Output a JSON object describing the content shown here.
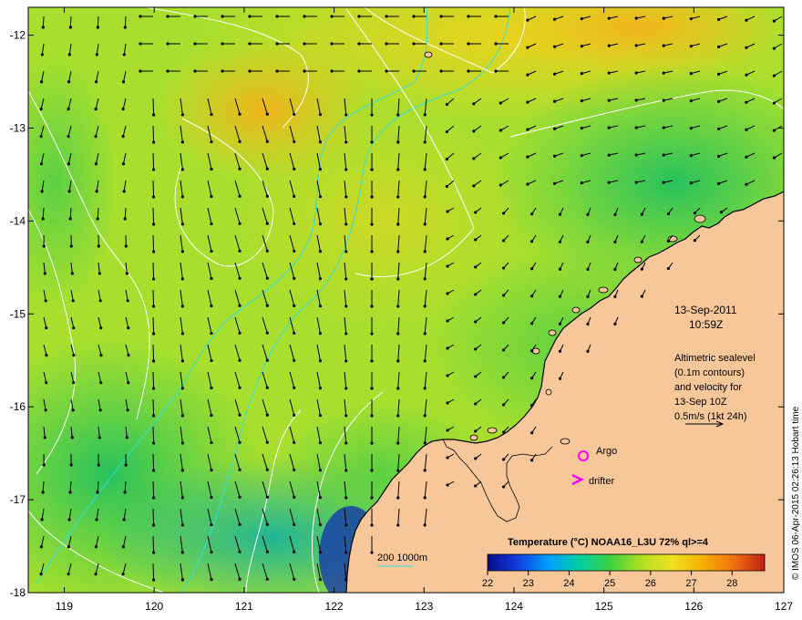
{
  "map": {
    "lon_range": [
      118.6,
      127
    ],
    "lat_range": [
      -18,
      -11.7
    ],
    "lon_ticks": [
      "119",
      "120",
      "121",
      "122",
      "123",
      "124",
      "125",
      "126",
      "127"
    ],
    "lat_ticks": [
      "-12",
      "-13",
      "-14",
      "-15",
      "-16",
      "-17",
      "-18"
    ],
    "land_color": "#f7c79a",
    "contour_color": "#ffffff",
    "bathymetry_color": "#2ee0e0",
    "arrow_color": "#000000"
  },
  "annotation": {
    "date": "13-Sep-2011",
    "time": "10:59Z",
    "lines": [
      "Altimetric sealevel",
      "(0.1m contours)",
      "and velocity for",
      "13-Sep 10Z",
      "0.5m/s (1kt 24h)"
    ]
  },
  "legend": {
    "argo_label": "Argo",
    "argo_color": "#ff00ff",
    "drifter_label": "drifter",
    "drifter_color": "#ff00ff",
    "bathy_label": "200  1000m"
  },
  "colorbar": {
    "title": "Temperature (°C) NOAA16_L3U 72% ql>=4",
    "ticks": [
      "22",
      "23",
      "24",
      "25",
      "26",
      "27",
      "28"
    ],
    "range": [
      22,
      28.8
    ],
    "colors": [
      "#0a0a8c",
      "#1040e0",
      "#00a0ff",
      "#00d0a0",
      "#40d040",
      "#b0e020",
      "#f0e020",
      "#f5b000",
      "#f07010",
      "#c02010"
    ]
  },
  "credit": "© IMOS 06-Apr-2015 02:26:13 Hobart time"
}
